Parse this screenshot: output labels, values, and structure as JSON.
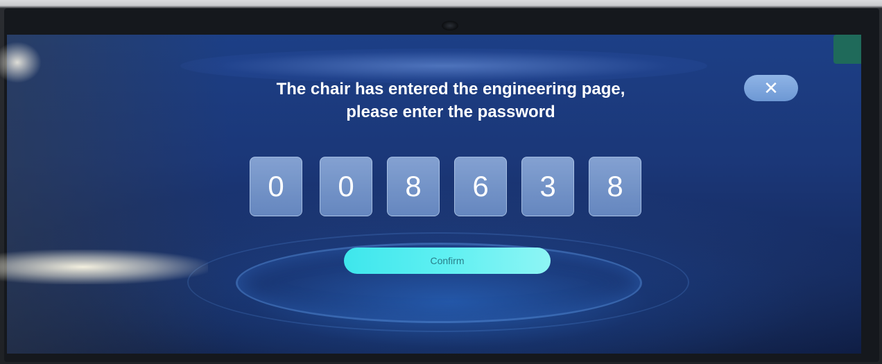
{
  "dialog": {
    "prompt_line1": "The chair has entered the engineering page,",
    "prompt_line2": "please enter the password",
    "close_icon": "close-icon",
    "close_glyph": "✕",
    "password_digits": [
      "0",
      "0",
      "8",
      "6",
      "3",
      "8"
    ],
    "confirm_label": "Confirm"
  },
  "colors": {
    "background": "#1b3778",
    "confirm_button": "#5ff0f2",
    "close_button": "#7da6dc",
    "digit_box": "#8aa9d9"
  }
}
